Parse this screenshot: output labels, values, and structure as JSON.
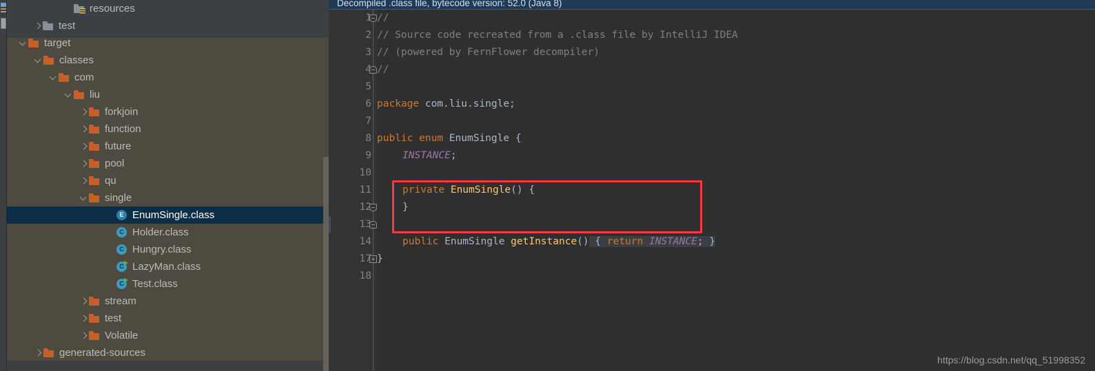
{
  "tool_stripe": {
    "icons": [
      "bookmark-icon",
      "orange-bar-icon",
      "gray-bar-icon",
      "tool-button-icon"
    ]
  },
  "project_tree": {
    "rows": [
      {
        "label": "resources",
        "indent": 103,
        "arrow": "none",
        "icon": "folder-resources-icon",
        "selected": false
      },
      {
        "label": "test",
        "indent": 58,
        "arrow": "closed",
        "icon": "folder-gray-icon",
        "selected": false
      },
      {
        "label": "target",
        "indent": 37,
        "arrow": "open",
        "icon": "folder-orange-icon",
        "selected": false
      },
      {
        "label": "classes",
        "indent": 59,
        "arrow": "open",
        "icon": "folder-orange-icon",
        "selected": false
      },
      {
        "label": "com",
        "indent": 81,
        "arrow": "open",
        "icon": "folder-orange-icon",
        "selected": false
      },
      {
        "label": "liu",
        "indent": 103,
        "arrow": "open",
        "icon": "folder-orange-icon",
        "selected": false
      },
      {
        "label": "forkjoin",
        "indent": 125,
        "arrow": "closed",
        "icon": "folder-orange-icon",
        "selected": false
      },
      {
        "label": "function",
        "indent": 125,
        "arrow": "closed",
        "icon": "folder-orange-icon",
        "selected": false
      },
      {
        "label": "future",
        "indent": 125,
        "arrow": "closed",
        "icon": "folder-orange-icon",
        "selected": false
      },
      {
        "label": "pool",
        "indent": 125,
        "arrow": "closed",
        "icon": "folder-orange-icon",
        "selected": false
      },
      {
        "label": "qu",
        "indent": 125,
        "arrow": "closed",
        "icon": "folder-orange-icon",
        "selected": false
      },
      {
        "label": "single",
        "indent": 125,
        "arrow": "open",
        "icon": "folder-orange-icon",
        "selected": false
      },
      {
        "label": "EnumSingle.class",
        "indent": 165,
        "arrow": "none",
        "icon": "enum-class-icon",
        "selected": true
      },
      {
        "label": "Holder.class",
        "indent": 165,
        "arrow": "none",
        "icon": "class-icon",
        "selected": false
      },
      {
        "label": "Hungry.class",
        "indent": 165,
        "arrow": "none",
        "icon": "class-icon",
        "selected": false
      },
      {
        "label": "LazyMan.class",
        "indent": 165,
        "arrow": "none",
        "icon": "class-runnable-icon",
        "selected": false
      },
      {
        "label": "Test.class",
        "indent": 165,
        "arrow": "none",
        "icon": "class-runnable-icon",
        "selected": false
      },
      {
        "label": "stream",
        "indent": 125,
        "arrow": "closed",
        "icon": "folder-orange-icon",
        "selected": false
      },
      {
        "label": "test",
        "indent": 125,
        "arrow": "closed",
        "icon": "folder-orange-icon",
        "selected": false
      },
      {
        "label": "Volatile",
        "indent": 125,
        "arrow": "closed",
        "icon": "folder-orange-icon",
        "selected": false
      },
      {
        "label": "generated-sources",
        "indent": 59,
        "arrow": "closed",
        "icon": "folder-orange-icon",
        "selected": false
      }
    ],
    "colors": {
      "panel_background": "#3c4043",
      "content_root_background": "#4f4a40",
      "selection_background": "#0d2d46",
      "folder_orange": "#c75f2b",
      "folder_gray": "#8a9097",
      "class_icon": "#3a9dc0",
      "enum_icon": "#2c7fa8",
      "run_badge": "#62b543"
    }
  },
  "editor": {
    "notification_banner": "Decompiled .class file, bytecode version: 52.0 (Java 8)",
    "line_numbers": [
      1,
      2,
      3,
      4,
      5,
      6,
      7,
      8,
      9,
      10,
      11,
      12,
      13,
      14,
      17,
      18
    ],
    "lines": [
      {
        "num": 1,
        "text": "//"
      },
      {
        "num": 2,
        "text": "// Source code recreated from a .class file by IntelliJ IDEA"
      },
      {
        "num": 3,
        "text": "// (powered by FernFlower decompiler)"
      },
      {
        "num": 4,
        "text": "//"
      },
      {
        "num": 5,
        "text": ""
      },
      {
        "num": 6,
        "text": "package com.liu.single;"
      },
      {
        "num": 7,
        "text": ""
      },
      {
        "num": 8,
        "text": "public enum EnumSingle {"
      },
      {
        "num": 9,
        "text": "    INSTANCE;"
      },
      {
        "num": 10,
        "text": ""
      },
      {
        "num": 11,
        "text": "    private EnumSingle() {"
      },
      {
        "num": 12,
        "text": "    }"
      },
      {
        "num": 13,
        "text": ""
      },
      {
        "num": 14,
        "text": "    public EnumSingle getInstance() { return INSTANCE; }"
      },
      {
        "num": 17,
        "text": "}"
      },
      {
        "num": 18,
        "text": ""
      }
    ],
    "tokens": {
      "comment_1": "//",
      "comment_2": "// Source code recreated from a .class file by IntelliJ IDEA",
      "comment_3": "// (powered by FernFlower decompiler)",
      "comment_4": "//",
      "kw_package": "package",
      "package_name": " com.liu.single;",
      "kw_public": "public",
      "kw_enum": " enum ",
      "type_enumsingle": "EnumSingle",
      "brace_open": " {",
      "const_instance": "INSTANCE",
      "semicolon": ";",
      "kw_private": "private",
      "ctor_name": " EnumSingle",
      "ctor_parens": "()",
      "ctor_brace": " {",
      "close_brace": "}",
      "kw_public_2": "public",
      "ret_type": " EnumSingle ",
      "method_name": "getInstance",
      "method_parens": "()",
      "fold_open_brace": " { ",
      "kw_return": "return ",
      "fold_instance": "INSTANCE",
      "fold_semicolon": "; ",
      "fold_close_brace": "}",
      "class_close": "}"
    },
    "fold_markers": [
      {
        "line": 1,
        "type": "fold-start"
      },
      {
        "line": 4,
        "type": "fold-end"
      },
      {
        "line": 11,
        "type": "fold-start"
      },
      {
        "line": 12,
        "type": "fold-end"
      },
      {
        "line": 14,
        "type": "fold-collapsed"
      }
    ],
    "colors": {
      "background": "#2f2f2f",
      "gutter": "#313335",
      "banner": "#1e3a57",
      "keyword": "#cc7832",
      "comment": "#808080",
      "constant": "#9876aa",
      "method": "#ffc66d",
      "default_text": "#a9b7c6"
    }
  },
  "annotation": {
    "name": "red-highlight-box",
    "color": "#fb3b3b",
    "covers": "private EnumSingle() { }"
  },
  "watermark": {
    "text": "https://blog.csdn.net/qq_51998352"
  }
}
